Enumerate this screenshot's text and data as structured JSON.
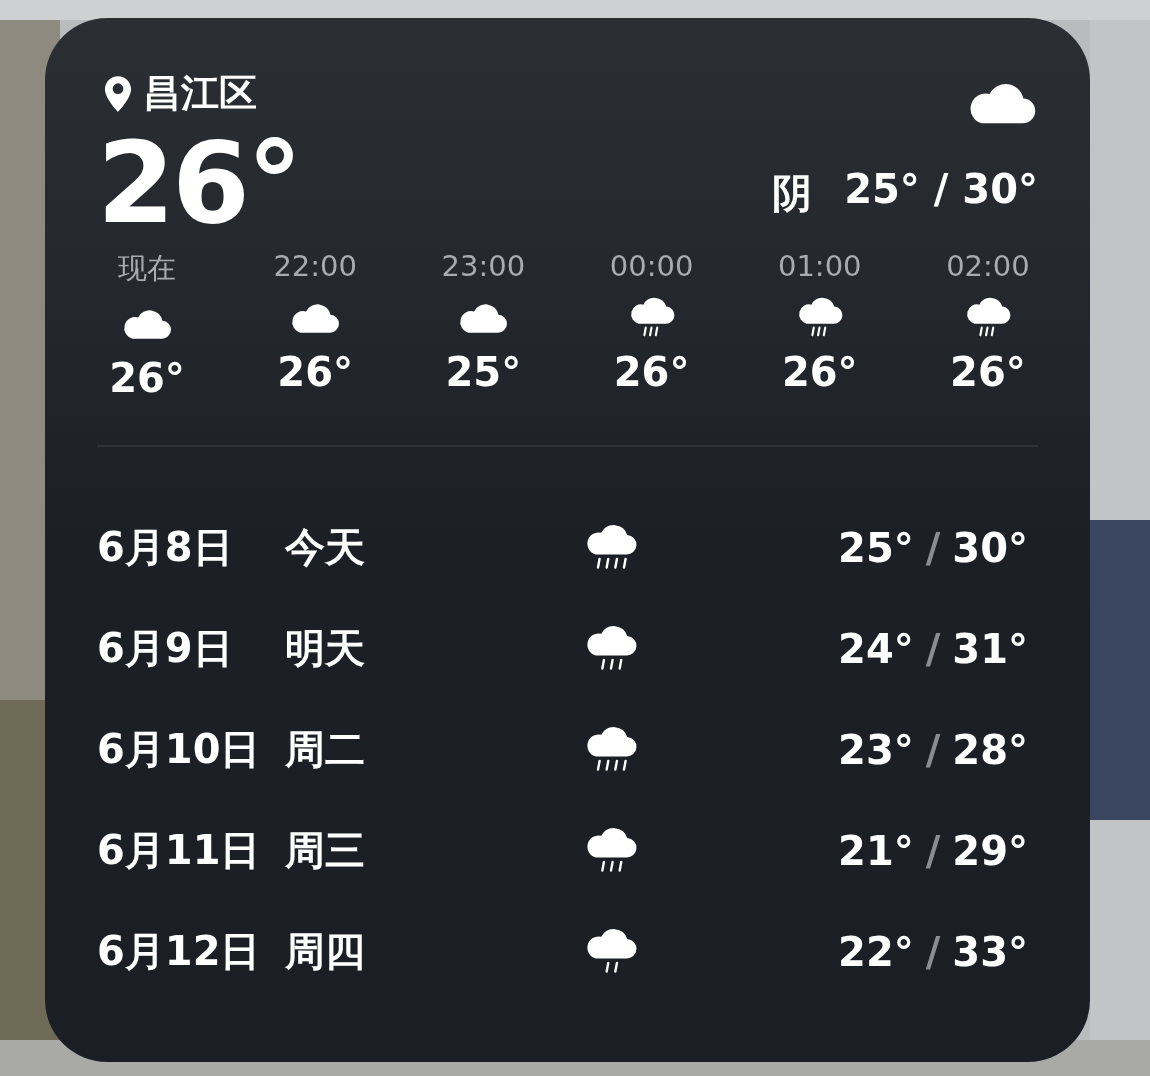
{
  "location": "昌江区",
  "temperature": "26°",
  "condition": "阴",
  "range": "25° / 30°",
  "hourly": [
    {
      "time": "现在",
      "kind": "cloudy",
      "temp": "26°"
    },
    {
      "time": "22:00",
      "kind": "cloudy",
      "temp": "26°"
    },
    {
      "time": "23:00",
      "kind": "cloudy",
      "temp": "25°"
    },
    {
      "time": "00:00",
      "kind": "rain",
      "temp": "26°"
    },
    {
      "time": "01:00",
      "kind": "rain",
      "temp": "26°"
    },
    {
      "time": "02:00",
      "kind": "rain",
      "temp": "26°"
    }
  ],
  "daily": [
    {
      "date": "6月8日",
      "day": "今天",
      "kind": "heavy-rain",
      "low": "25°",
      "separator": "/",
      "high": "30°"
    },
    {
      "date": "6月9日",
      "day": "明天",
      "kind": "rain",
      "low": "24°",
      "separator": "/",
      "high": "31°"
    },
    {
      "date": "6月10日",
      "day": "周二",
      "kind": "heavy-rain",
      "low": "23°",
      "separator": "/",
      "high": "28°"
    },
    {
      "date": "6月11日",
      "day": "周三",
      "kind": "rain",
      "low": "21°",
      "separator": "/",
      "high": "29°"
    },
    {
      "date": "6月12日",
      "day": "周四",
      "kind": "light-rain",
      "low": "22°",
      "separator": "/",
      "high": "33°"
    }
  ]
}
